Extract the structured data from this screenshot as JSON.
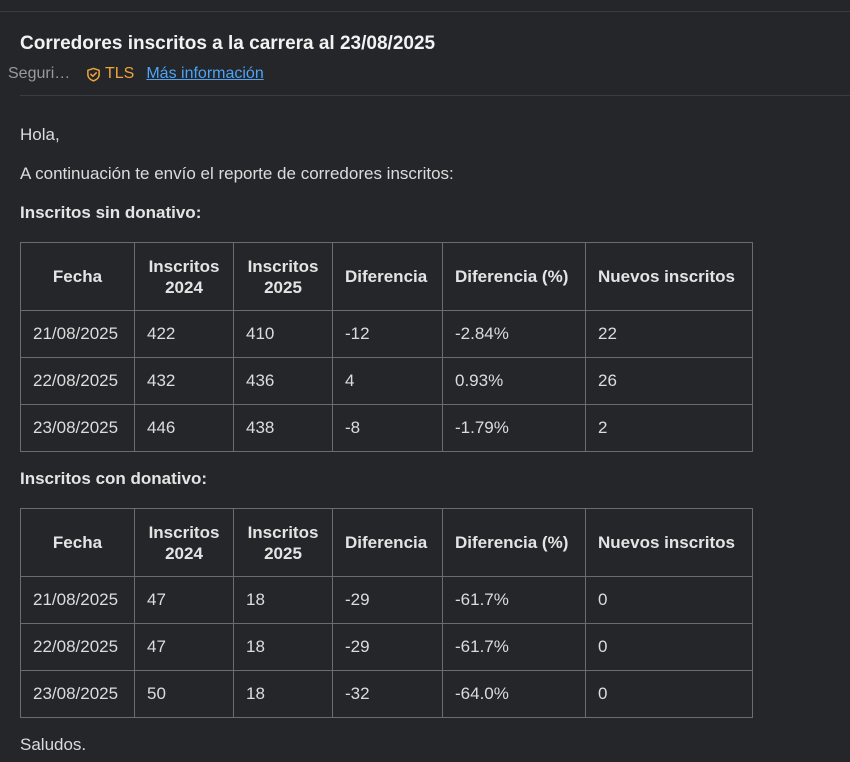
{
  "email": {
    "subject": "Corredores inscritos a la carrera al 23/08/2025",
    "security_label": "Seguri…",
    "security_icon": "shield-check-icon",
    "tls_label": "TLS",
    "more_info_link": "Más información"
  },
  "body": {
    "greeting": "Hola,",
    "intro": "A continuación te envío el reporte de corredores inscritos:",
    "section1_title": "Inscritos sin donativo:",
    "section2_title": "Inscritos con donativo:",
    "closing": "Saludos."
  },
  "tables": {
    "headers": {
      "col1": "Fecha",
      "col2_line1": "Inscritos",
      "col2_line2": "2024",
      "col3_line1": "Inscritos",
      "col3_line2": "2025",
      "col4": "Diferencia",
      "col5": "Diferencia (%)",
      "col6": "Nuevos inscritos"
    },
    "sin_donativo": [
      {
        "fecha": "21/08/2025",
        "inscritos_2024": "422",
        "inscritos_2025": "410",
        "diferencia": "-12",
        "diferencia_pct": "-2.84%",
        "nuevos": "22"
      },
      {
        "fecha": "22/08/2025",
        "inscritos_2024": "432",
        "inscritos_2025": "436",
        "diferencia": "4",
        "diferencia_pct": "0.93%",
        "nuevos": "26"
      },
      {
        "fecha": "23/08/2025",
        "inscritos_2024": "446",
        "inscritos_2025": "438",
        "diferencia": "-8",
        "diferencia_pct": "-1.79%",
        "nuevos": "2"
      }
    ],
    "con_donativo": [
      {
        "fecha": "21/08/2025",
        "inscritos_2024": "47",
        "inscritos_2025": "18",
        "diferencia": "-29",
        "diferencia_pct": "-61.7%",
        "nuevos": "0"
      },
      {
        "fecha": "22/08/2025",
        "inscritos_2024": "47",
        "inscritos_2025": "18",
        "diferencia": "-29",
        "diferencia_pct": "-61.7%",
        "nuevos": "0"
      },
      {
        "fecha": "23/08/2025",
        "inscritos_2024": "50",
        "inscritos_2025": "18",
        "diferencia": "-32",
        "diferencia_pct": "-64.0%",
        "nuevos": "0"
      }
    ]
  },
  "colors": {
    "background": "#242629",
    "text": "#dcdcdc",
    "tls_accent": "#f2a33a",
    "link": "#4ea3f5",
    "table_border": "#6a6c70"
  }
}
